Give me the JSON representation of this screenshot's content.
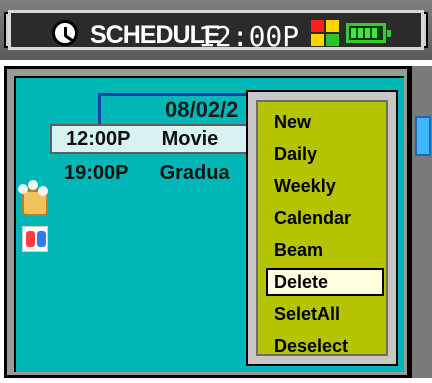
{
  "header": {
    "app_title": "SCHEDULE",
    "time": "12:00P",
    "icons": [
      "clock-icon",
      "color-grid-icon",
      "battery-icon"
    ]
  },
  "schedule": {
    "date": "08/02/2",
    "events": [
      {
        "time": "12:00P",
        "title": "Movie",
        "icon": "coffee-cup-icon",
        "selected": true
      },
      {
        "time": "19:00P",
        "title": "Gradua",
        "icon": "people-icon",
        "selected": false
      }
    ]
  },
  "menu": {
    "items": [
      {
        "label": "New",
        "active": false
      },
      {
        "label": "Daily",
        "active": false
      },
      {
        "label": "Weekly",
        "active": false
      },
      {
        "label": "Calendar",
        "active": false
      },
      {
        "label": "Beam",
        "active": false
      },
      {
        "label": "Delete",
        "active": true
      },
      {
        "label": "SeletAll",
        "active": false
      },
      {
        "label": "Deselect",
        "active": false
      }
    ]
  },
  "colors": {
    "panel_teal": "#00b7b7",
    "menu_yellow_green": "#b5c400",
    "selection_highlight": "#ffffe0"
  }
}
